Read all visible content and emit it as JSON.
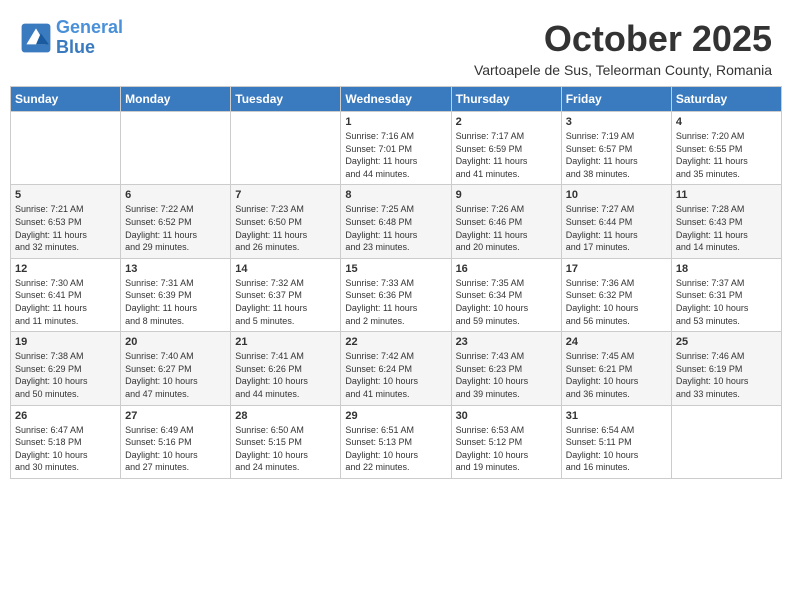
{
  "header": {
    "logo_line1": "General",
    "logo_line2": "Blue",
    "month": "October 2025",
    "location": "Vartoapele de Sus, Teleorman County, Romania"
  },
  "weekdays": [
    "Sunday",
    "Monday",
    "Tuesday",
    "Wednesday",
    "Thursday",
    "Friday",
    "Saturday"
  ],
  "weeks": [
    [
      {
        "day": "",
        "info": ""
      },
      {
        "day": "",
        "info": ""
      },
      {
        "day": "",
        "info": ""
      },
      {
        "day": "1",
        "info": "Sunrise: 7:16 AM\nSunset: 7:01 PM\nDaylight: 11 hours\nand 44 minutes."
      },
      {
        "day": "2",
        "info": "Sunrise: 7:17 AM\nSunset: 6:59 PM\nDaylight: 11 hours\nand 41 minutes."
      },
      {
        "day": "3",
        "info": "Sunrise: 7:19 AM\nSunset: 6:57 PM\nDaylight: 11 hours\nand 38 minutes."
      },
      {
        "day": "4",
        "info": "Sunrise: 7:20 AM\nSunset: 6:55 PM\nDaylight: 11 hours\nand 35 minutes."
      }
    ],
    [
      {
        "day": "5",
        "info": "Sunrise: 7:21 AM\nSunset: 6:53 PM\nDaylight: 11 hours\nand 32 minutes."
      },
      {
        "day": "6",
        "info": "Sunrise: 7:22 AM\nSunset: 6:52 PM\nDaylight: 11 hours\nand 29 minutes."
      },
      {
        "day": "7",
        "info": "Sunrise: 7:23 AM\nSunset: 6:50 PM\nDaylight: 11 hours\nand 26 minutes."
      },
      {
        "day": "8",
        "info": "Sunrise: 7:25 AM\nSunset: 6:48 PM\nDaylight: 11 hours\nand 23 minutes."
      },
      {
        "day": "9",
        "info": "Sunrise: 7:26 AM\nSunset: 6:46 PM\nDaylight: 11 hours\nand 20 minutes."
      },
      {
        "day": "10",
        "info": "Sunrise: 7:27 AM\nSunset: 6:44 PM\nDaylight: 11 hours\nand 17 minutes."
      },
      {
        "day": "11",
        "info": "Sunrise: 7:28 AM\nSunset: 6:43 PM\nDaylight: 11 hours\nand 14 minutes."
      }
    ],
    [
      {
        "day": "12",
        "info": "Sunrise: 7:30 AM\nSunset: 6:41 PM\nDaylight: 11 hours\nand 11 minutes."
      },
      {
        "day": "13",
        "info": "Sunrise: 7:31 AM\nSunset: 6:39 PM\nDaylight: 11 hours\nand 8 minutes."
      },
      {
        "day": "14",
        "info": "Sunrise: 7:32 AM\nSunset: 6:37 PM\nDaylight: 11 hours\nand 5 minutes."
      },
      {
        "day": "15",
        "info": "Sunrise: 7:33 AM\nSunset: 6:36 PM\nDaylight: 11 hours\nand 2 minutes."
      },
      {
        "day": "16",
        "info": "Sunrise: 7:35 AM\nSunset: 6:34 PM\nDaylight: 10 hours\nand 59 minutes."
      },
      {
        "day": "17",
        "info": "Sunrise: 7:36 AM\nSunset: 6:32 PM\nDaylight: 10 hours\nand 56 minutes."
      },
      {
        "day": "18",
        "info": "Sunrise: 7:37 AM\nSunset: 6:31 PM\nDaylight: 10 hours\nand 53 minutes."
      }
    ],
    [
      {
        "day": "19",
        "info": "Sunrise: 7:38 AM\nSunset: 6:29 PM\nDaylight: 10 hours\nand 50 minutes."
      },
      {
        "day": "20",
        "info": "Sunrise: 7:40 AM\nSunset: 6:27 PM\nDaylight: 10 hours\nand 47 minutes."
      },
      {
        "day": "21",
        "info": "Sunrise: 7:41 AM\nSunset: 6:26 PM\nDaylight: 10 hours\nand 44 minutes."
      },
      {
        "day": "22",
        "info": "Sunrise: 7:42 AM\nSunset: 6:24 PM\nDaylight: 10 hours\nand 41 minutes."
      },
      {
        "day": "23",
        "info": "Sunrise: 7:43 AM\nSunset: 6:23 PM\nDaylight: 10 hours\nand 39 minutes."
      },
      {
        "day": "24",
        "info": "Sunrise: 7:45 AM\nSunset: 6:21 PM\nDaylight: 10 hours\nand 36 minutes."
      },
      {
        "day": "25",
        "info": "Sunrise: 7:46 AM\nSunset: 6:19 PM\nDaylight: 10 hours\nand 33 minutes."
      }
    ],
    [
      {
        "day": "26",
        "info": "Sunrise: 6:47 AM\nSunset: 5:18 PM\nDaylight: 10 hours\nand 30 minutes."
      },
      {
        "day": "27",
        "info": "Sunrise: 6:49 AM\nSunset: 5:16 PM\nDaylight: 10 hours\nand 27 minutes."
      },
      {
        "day": "28",
        "info": "Sunrise: 6:50 AM\nSunset: 5:15 PM\nDaylight: 10 hours\nand 24 minutes."
      },
      {
        "day": "29",
        "info": "Sunrise: 6:51 AM\nSunset: 5:13 PM\nDaylight: 10 hours\nand 22 minutes."
      },
      {
        "day": "30",
        "info": "Sunrise: 6:53 AM\nSunset: 5:12 PM\nDaylight: 10 hours\nand 19 minutes."
      },
      {
        "day": "31",
        "info": "Sunrise: 6:54 AM\nSunset: 5:11 PM\nDaylight: 10 hours\nand 16 minutes."
      },
      {
        "day": "",
        "info": ""
      }
    ]
  ]
}
